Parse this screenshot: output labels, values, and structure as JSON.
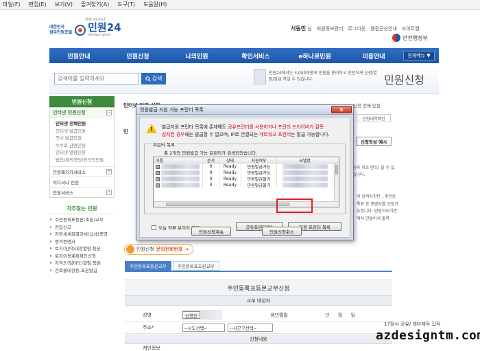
{
  "browser_menu": [
    "파일(F)",
    "편집(E)",
    "보기(V)",
    "즐겨찾기(A)",
    "도구(T)",
    "도움말(H)"
  ],
  "header": {
    "logo_top": "대한민국",
    "logo_bottom": "정부민원포털",
    "logo_tagline": "언제 어디서나",
    "logo_name": "민원24",
    "logo_url": "minwon.go.kr",
    "user_name": "서동민",
    "user_suffix": "님",
    "user_links": [
      "회원정보관리",
      "로그아웃",
      "웹접근성안내",
      "사이트맵"
    ],
    "gov_label": "안전행정부"
  },
  "nav": {
    "items": [
      "민원안내",
      "민원신청",
      "나의민원",
      "확인서비스",
      "e하나로민원",
      "이용안내"
    ],
    "all_menu": "전체메뉴 ▼"
  },
  "search": {
    "placeholder": "검색어를 입력하세요",
    "button": "검색"
  },
  "promo": {
    "text": "민원24에서는 3,000여종의 민원을 편리하고 안전하게 신청/열람/발급 하실 수 있습니다.",
    "title": "민원신청"
  },
  "sidebar": {
    "head": "민원신청",
    "cat_title": "인터넷 민원신청",
    "sub_items": [
      "인터넷 전체민원",
      "인터넷 발급민원",
      "즉시 발급민원",
      "수수료 감면민원",
      "인터넷 열람민원",
      "법인/재외국민/외국인민원"
    ],
    "other_cats": [
      "민원패키지서비스",
      "어디서나 민원",
      "민원서비스"
    ],
    "fav_head": "자주찾는 민원",
    "fav_items": [
      "주민등록표등본(초본)교부",
      "전입신고",
      "지방세세목별과세(납세)증명",
      "병적증명서",
      "토지(임야)대장열람.등본",
      "토지이용계획확인신청",
      "지적도(임야도)열람.등본",
      "건축물대장등.초본발급"
    ]
  },
  "content": {
    "title": "인터넷 민원 신청",
    "subtitle": "민",
    "crumb": "신청 전체 민원",
    "right_tab": "신청내역확인",
    "example_btn": "신청작성 예시",
    "right_text": "등의 위조·변조) 을 수 있습니다.",
    "right_text2": "이 입력사항만 , 주민등록표 등 증명서를 신청가능합니다. 민원처리기관에서 만들어서 볼록",
    "phone_label": "민원신청",
    "phone_hl": "문의전화번호",
    "tabs": [
      "주민등록표등본교부",
      "주민등록표초본교부"
    ],
    "form_title": "주민등록표등본교부신청",
    "section1": "교부 대상자",
    "name_label": "성명",
    "name_btn": "신청인",
    "birth_label": "생년월일",
    "birth_value": "년 월 일",
    "addr_label": "주소*",
    "addr_sel1": "--시도선택--",
    "addr_sel2": "--시군구선택--",
    "section2": "신청내용",
    "row_partial": "개인정보"
  },
  "modal": {
    "title": "민원발급 지원 가능 프린터 목록",
    "close": "X",
    "warn_line1_a": "발급지원 프린터 목록에 존재해도 ",
    "warn_line1_red": "공유프린터를 사용하거나 프린터 드라이버가 잘못",
    "warn_line2_red1": "설치된 경우",
    "warn_line2_b": "에는 발급할 수 없으며, IP로 연결되는 ",
    "warn_line2_red2": "네트워크 프린터",
    "warn_line2_c": "는 발급 가능합니다.",
    "list_legend": "프린터 목록",
    "found": "총 2개의 민원발급 가능 프린터가 검색되었습니다.",
    "columns": [
      "이름",
      "문서",
      "상태",
      "지원여부",
      "모델명"
    ],
    "rows": [
      {
        "docs": "0",
        "status": "Ready",
        "support": "민원발급가능"
      },
      {
        "docs": "0",
        "status": "Ready",
        "support": "민원발급가능"
      },
      {
        "docs": "0",
        "status": "Ready",
        "support": "민원발급불가"
      },
      {
        "docs": "0",
        "status": "Ready",
        "support": "민원발급불가"
      }
    ],
    "checkbox": "오늘 하루 보이지 않기",
    "btn_shared": "공유프린터란?",
    "btn_supported": "지원 프린터 목록",
    "btn_continue": "민원신청계속",
    "btn_cancel": "민원신청취소"
  },
  "watermark": {
    "line1": "17점식 공유/ 레아제작 갑작",
    "line2": "azdesigntm.com"
  }
}
